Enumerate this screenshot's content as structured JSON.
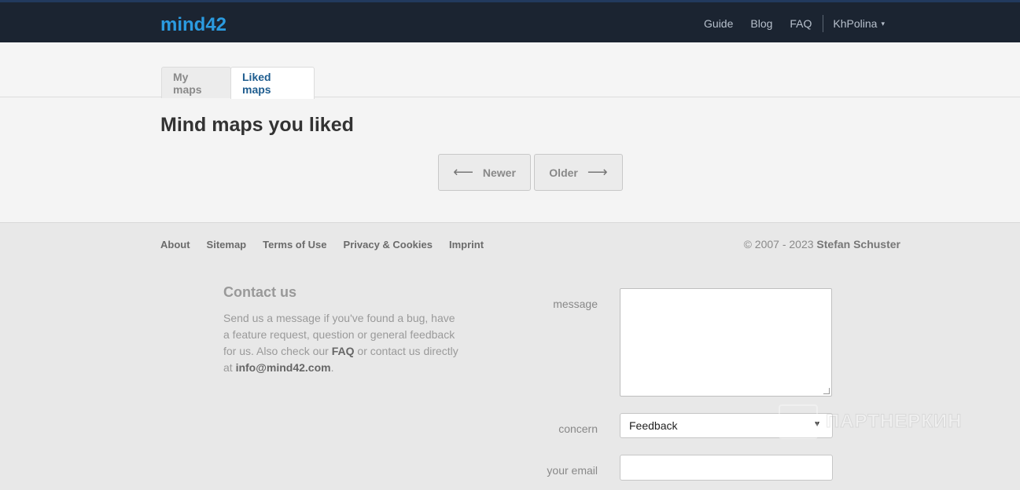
{
  "header": {
    "logo_text": "mind42",
    "nav": [
      {
        "label": "Guide"
      },
      {
        "label": "Blog"
      },
      {
        "label": "FAQ"
      }
    ],
    "user": {
      "name": "KhPolina",
      "caret": "▾"
    }
  },
  "tabs": [
    {
      "label": "My maps",
      "active": false
    },
    {
      "label": "Liked maps",
      "active": true
    }
  ],
  "page_title": "Mind maps you liked",
  "pager": {
    "newer_label": "Newer",
    "older_label": "Older",
    "left_arrow": "⟵",
    "right_arrow": "⟶"
  },
  "footer": {
    "links": [
      "About",
      "Sitemap",
      "Terms of Use",
      "Privacy & Cookies",
      "Imprint"
    ],
    "copyright_prefix": "© 2007 - 2023",
    "copyright_name": "Stefan Schuster"
  },
  "contact": {
    "title": "Contact us",
    "text_1": "Send us a message if you've found a bug, have a feature request, question or general feedback for us. Also check our ",
    "faq_link": "FAQ",
    "text_2": " or contact us directly at ",
    "email_link": "info@mind42.com",
    "text_3": "."
  },
  "form": {
    "message_label": "message",
    "message_value": "",
    "concern_label": "concern",
    "concern_selected": "Feedback",
    "email_label": "your email",
    "email_value": ""
  },
  "watermark": {
    "text": "ПАРТНЕРКИН"
  },
  "colors": {
    "topbar": "#1b2431",
    "logo": "#2b9be0",
    "active_tab": "#1f5d8f"
  }
}
